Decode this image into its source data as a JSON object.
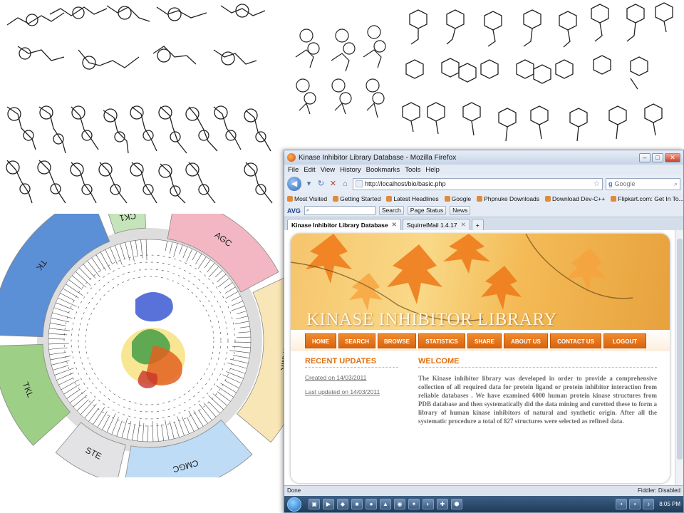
{
  "figure": {
    "kinome_groups": [
      {
        "label": "AGC",
        "color": "#f3b7c4"
      },
      {
        "label": "CAMK",
        "color": "#f9e6b6"
      },
      {
        "label": "CMGC",
        "color": "#bfdcf7"
      },
      {
        "label": "STE",
        "color": "#e3e3e6"
      },
      {
        "label": "TKL",
        "color": "#9ecf86"
      },
      {
        "label": "TK",
        "color": "#5b8fd6"
      },
      {
        "label": "CK1",
        "color": "#c5e4b9"
      }
    ]
  },
  "browser": {
    "window_title": "Kinase Inhibitor Library Database - Mozilla Firefox",
    "menu": [
      "File",
      "Edit",
      "View",
      "History",
      "Bookmarks",
      "Tools",
      "Help"
    ],
    "url": "http://localhost/bio/basic.php",
    "search_placeholder": "Google",
    "bookmarks": [
      "Most Visited",
      "Getting Started",
      "Latest Headlines",
      "Google",
      "Phpnuke Downloads",
      "Download Dev-C++",
      "Flipkart.com: Get In To..."
    ],
    "toolbar": {
      "brand": "AVG",
      "search_button": "Search",
      "page_status": "Page Status",
      "news": "News"
    },
    "tabs": [
      {
        "label": "Kinase Inhibitor Library Database",
        "active": true
      },
      {
        "label": "SquirrelMail 1.4.17",
        "active": false
      }
    ],
    "status_left": "Done",
    "status_right": "Fiddler: Disabled"
  },
  "site": {
    "banner_title": "KINASE INHIBITOR LIBRARY",
    "nav": [
      "HOME",
      "SEARCH",
      "BROWSE",
      "STATISTICS",
      "SHARE",
      "ABOUT US",
      "CONTACT US",
      "LOGOUT"
    ],
    "updates": {
      "heading": "RECENT UPDATES",
      "created": "Created on 14/03/2011",
      "updated": "Last updated on 14/03/2011"
    },
    "welcome": {
      "heading": "WELCOME",
      "text": "The Kinase inhibitor library was developed in order to provide a comprehensive collection of all required data for protein ligand or protein inhibitor interaction from reliable databases . We have examined 6000 human protein kinase structures from PDB database and then systematically did the data mining and curetted these to form a library of human kinase inhibitors of natural and synthetic origin. After all the systematic procedure a total of 827 structures were selected as refined data."
    }
  },
  "taskbar": {
    "clock": "8:05 PM"
  }
}
